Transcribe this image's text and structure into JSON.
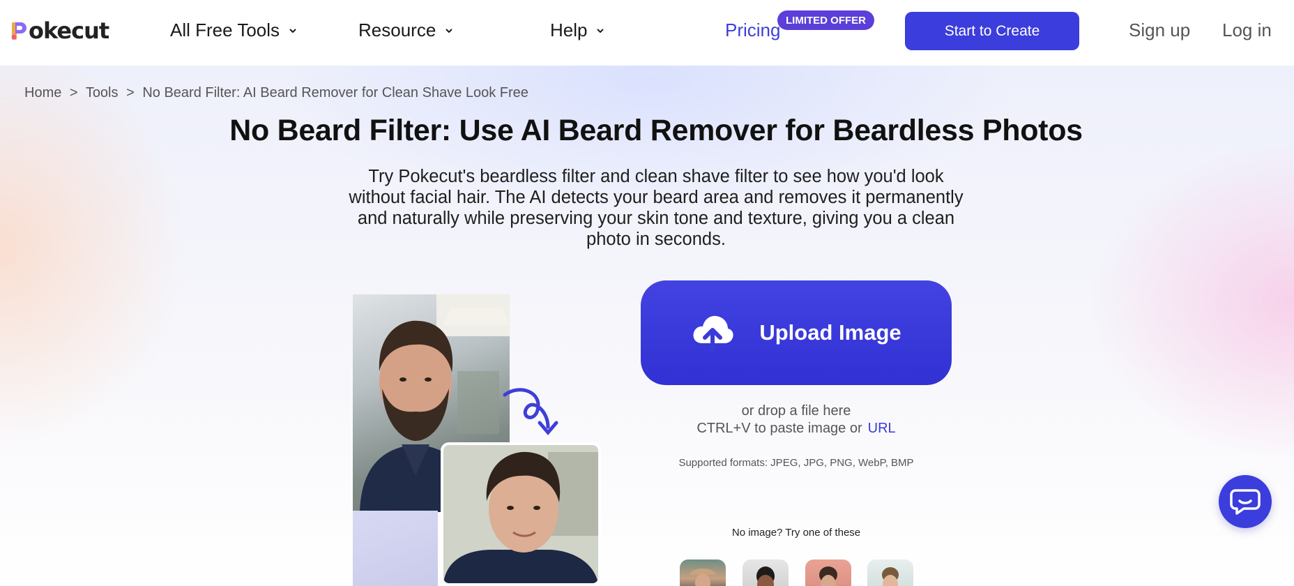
{
  "header": {
    "logo_text": "okecut",
    "nav": {
      "all_free_tools": "All Free Tools",
      "resource": "Resource",
      "help": "Help",
      "pricing": "Pricing",
      "limited_offer": "LIMITED OFFER"
    },
    "start_button": "Start to Create",
    "sign_up": "Sign up",
    "log_in": "Log in"
  },
  "breadcrumb": {
    "home": "Home",
    "sep1": ">",
    "tools": "Tools",
    "sep2": ">",
    "current": "No Beard Filter: AI Beard Remover for Clean Shave Look Free"
  },
  "hero": {
    "title": "No Beard Filter: Use AI Beard Remover for Beardless Photos",
    "description": "Try Pokecut's beardless filter and clean shave filter to see how you'd look without facial hair. The AI detects your beard area and removes it permanently and naturally while preserving your skin tone and texture, giving you a clean photo in seconds."
  },
  "upload": {
    "button_label": "Upload Image",
    "drop_text": "or drop a file here",
    "paste_text": "CTRL+V to paste image or",
    "url_link": "URL",
    "formats": "Supported formats: JPEG, JPG, PNG, WebP, BMP"
  },
  "samples": {
    "prompt": "No image? Try one of these"
  },
  "colors": {
    "accent": "#3b3ddc",
    "offer_badge": "#5b3fd8",
    "pricing_link": "#3e3fd8"
  }
}
